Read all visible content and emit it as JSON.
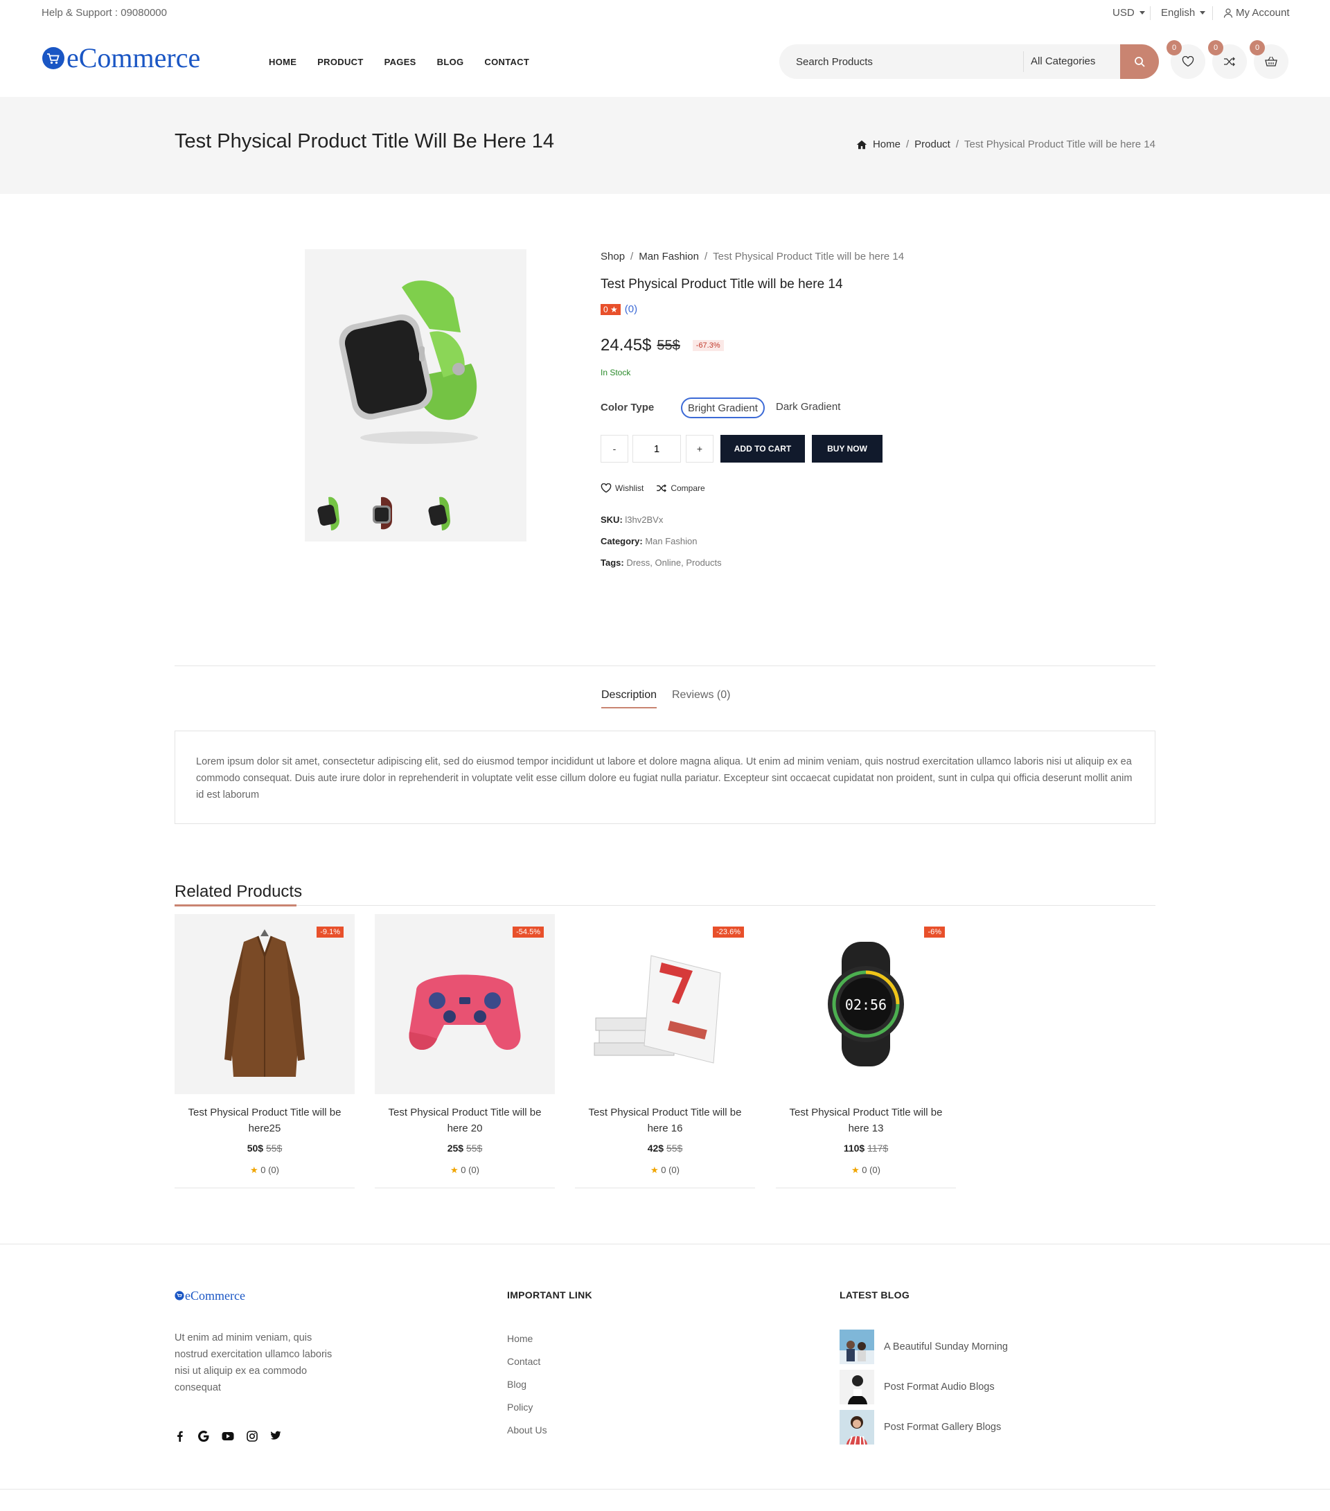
{
  "topbar": {
    "help": "Help & Support : 09080000",
    "currency": "USD",
    "language": "English",
    "account": "My Account"
  },
  "header": {
    "logo": "eCommerce",
    "nav": [
      "HOME",
      "PRODUCT",
      "PAGES",
      "BLOG",
      "CONTACT"
    ],
    "search_placeholder": "Search Products",
    "search_category": "All Categories",
    "wishlist_count": "0",
    "compare_count": "0",
    "cart_count": "0"
  },
  "page": {
    "title": "Test Physical Product Title Will Be Here 14",
    "breadcrumb": [
      "Home",
      "Product",
      "Test Physical Product Title will be here 14"
    ]
  },
  "product": {
    "breadcrumb": [
      "Shop",
      "Man Fashion",
      "Test Physical Product Title will be here 14"
    ],
    "title": "Test Physical Product Title will be here 14",
    "rating": "0",
    "rating_count": "(0)",
    "price": "24.45$",
    "old_price": "55$",
    "discount": "-67.3%",
    "stock": "In Stock",
    "color_label": "Color Type",
    "colors": [
      "Bright Gradient",
      "Dark Gradient"
    ],
    "qty_minus": "-",
    "qty_value": "1",
    "qty_plus": "+",
    "add_to_cart": "ADD TO CART",
    "buy_now": "BUY NOW",
    "wishlist": "Wishlist",
    "compare": "Compare",
    "sku_label": "SKU:",
    "sku": "l3hv2BVx",
    "category_label": "Category:",
    "category": "Man Fashion",
    "tags_label": "Tags:",
    "tags": [
      "Dress",
      "Online",
      "Products"
    ]
  },
  "tabs": [
    "Description",
    "Reviews (0)"
  ],
  "description": "Lorem ipsum dolor sit amet, consectetur adipiscing elit, sed do eiusmod tempor incididunt ut labore et dolore magna aliqua. Ut enim ad minim veniam, quis nostrud exercitation ullamco laboris nisi ut aliquip ex ea commodo consequat. Duis aute irure dolor in reprehenderit in voluptate velit esse cillum dolore eu fugiat nulla pariatur. Excepteur sint occaecat cupidatat non proident, sunt in culpa qui officia deserunt mollit anim id est laborum",
  "related": {
    "title": "Related Products",
    "items": [
      {
        "title": "Test Physical Product Title will be here25",
        "price": "50$",
        "old_price": "55$",
        "badge": "-9.1%",
        "rating": "0 (0)"
      },
      {
        "title": "Test Physical Product Title will be here 20",
        "price": "25$",
        "old_price": "55$",
        "badge": "-54.5%",
        "rating": "0 (0)"
      },
      {
        "title": "Test Physical Product Title will be here 16",
        "price": "42$",
        "old_price": "55$",
        "badge": "-23.6%",
        "rating": "0 (0)"
      },
      {
        "title": "Test Physical Product Title will be here 13",
        "price": "110$",
        "old_price": "117$",
        "badge": "-6%",
        "rating": "0 (0)"
      }
    ]
  },
  "footer": {
    "logo": "eCommerce",
    "about": "Ut enim ad minim veniam, quis nostrud exercitation ullamco laboris nisi ut aliquip ex ea commodo consequat",
    "links_title": "IMPORTANT LINK",
    "links": [
      "Home",
      "Contact",
      "Blog",
      "Policy",
      "About Us"
    ],
    "blog_title": "LATEST BLOG",
    "blogs": [
      "A Beautiful Sunday Morning",
      "Post Format Audio Blogs",
      "Post Format Gallery Blogs"
    ]
  },
  "colors": {
    "accent": "#c98471",
    "brand_blue": "#1a56c4",
    "badge_red": "#e8502b",
    "dark_button": "#111a2c"
  }
}
